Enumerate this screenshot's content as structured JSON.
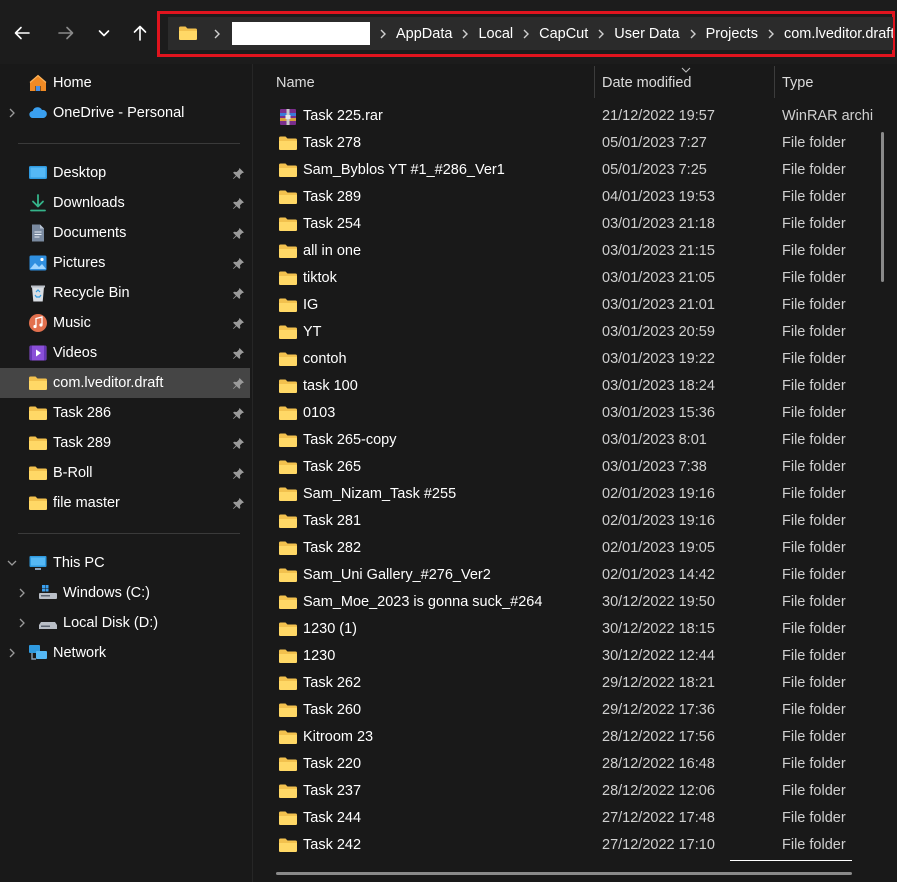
{
  "breadcrumb": {
    "items": [
      "AppData",
      "Local",
      "CapCut",
      "User Data",
      "Projects",
      "com.lveditor.draft"
    ]
  },
  "sidebar": {
    "quick": [
      {
        "label": "Home",
        "icon": "home-icon"
      },
      {
        "label": "OneDrive - Personal",
        "icon": "onedrive-cloud-icon"
      }
    ],
    "pinned": [
      {
        "label": "Desktop",
        "icon": "desktop-icon"
      },
      {
        "label": "Downloads",
        "icon": "download-icon"
      },
      {
        "label": "Documents",
        "icon": "documents-icon"
      },
      {
        "label": "Pictures",
        "icon": "pictures-icon"
      },
      {
        "label": "Recycle Bin",
        "icon": "recycle-bin-icon"
      },
      {
        "label": "Music",
        "icon": "music-icon"
      },
      {
        "label": "Videos",
        "icon": "videos-icon"
      },
      {
        "label": "com.lveditor.draft",
        "icon": "folder-icon"
      },
      {
        "label": "Task 286",
        "icon": "folder-icon"
      },
      {
        "label": "Task 289",
        "icon": "folder-icon"
      },
      {
        "label": "B-Roll",
        "icon": "folder-icon"
      },
      {
        "label": "file master",
        "icon": "folder-icon"
      }
    ],
    "devices": [
      {
        "label": "This PC",
        "icon": "pc-icon"
      },
      {
        "label": "Windows (C:)",
        "icon": "windows-drive-icon"
      },
      {
        "label": "Local Disk (D:)",
        "icon": "disk-drive-icon"
      },
      {
        "label": "Network",
        "icon": "network-icon"
      }
    ]
  },
  "columns": {
    "name": "Name",
    "date": "Date modified",
    "type": "Type"
  },
  "files": [
    {
      "name": "Task 225.rar",
      "date": "21/12/2022 19:57",
      "type": "WinRAR archi",
      "icon": "winrar-icon"
    },
    {
      "name": "Task 278",
      "date": "05/01/2023 7:27",
      "type": "File folder",
      "icon": "folder-icon"
    },
    {
      "name": "Sam_Byblos YT #1_#286_Ver1",
      "date": "05/01/2023 7:25",
      "type": "File folder",
      "icon": "folder-icon"
    },
    {
      "name": "Task 289",
      "date": "04/01/2023 19:53",
      "type": "File folder",
      "icon": "folder-icon"
    },
    {
      "name": "Task 254",
      "date": "03/01/2023 21:18",
      "type": "File folder",
      "icon": "folder-icon"
    },
    {
      "name": "all in one",
      "date": "03/01/2023 21:15",
      "type": "File folder",
      "icon": "folder-icon"
    },
    {
      "name": "tiktok",
      "date": "03/01/2023 21:05",
      "type": "File folder",
      "icon": "folder-icon"
    },
    {
      "name": "IG",
      "date": "03/01/2023 21:01",
      "type": "File folder",
      "icon": "folder-icon"
    },
    {
      "name": "YT",
      "date": "03/01/2023 20:59",
      "type": "File folder",
      "icon": "folder-icon"
    },
    {
      "name": "contoh",
      "date": "03/01/2023 19:22",
      "type": "File folder",
      "icon": "folder-icon"
    },
    {
      "name": "task 100",
      "date": "03/01/2023 18:24",
      "type": "File folder",
      "icon": "folder-icon"
    },
    {
      "name": "0103",
      "date": "03/01/2023 15:36",
      "type": "File folder",
      "icon": "folder-icon"
    },
    {
      "name": "Task 265-copy",
      "date": "03/01/2023 8:01",
      "type": "File folder",
      "icon": "folder-icon"
    },
    {
      "name": "Task 265",
      "date": "03/01/2023 7:38",
      "type": "File folder",
      "icon": "folder-icon"
    },
    {
      "name": "Sam_Nizam_Task #255",
      "date": "02/01/2023 19:16",
      "type": "File folder",
      "icon": "folder-icon"
    },
    {
      "name": "Task 281",
      "date": "02/01/2023 19:16",
      "type": "File folder",
      "icon": "folder-icon"
    },
    {
      "name": "Task 282",
      "date": "02/01/2023 19:05",
      "type": "File folder",
      "icon": "folder-icon"
    },
    {
      "name": "Sam_Uni Gallery_#276_Ver2",
      "date": "02/01/2023 14:42",
      "type": "File folder",
      "icon": "folder-icon"
    },
    {
      "name": "Sam_Moe_2023 is gonna suck_#264",
      "date": "30/12/2022 19:50",
      "type": "File folder",
      "icon": "folder-icon"
    },
    {
      "name": "1230 (1)",
      "date": "30/12/2022 18:15",
      "type": "File folder",
      "icon": "folder-icon"
    },
    {
      "name": "1230",
      "date": "30/12/2022 12:44",
      "type": "File folder",
      "icon": "folder-icon"
    },
    {
      "name": "Task 262",
      "date": "29/12/2022 18:21",
      "type": "File folder",
      "icon": "folder-icon"
    },
    {
      "name": "Task 260",
      "date": "29/12/2022 17:36",
      "type": "File folder",
      "icon": "folder-icon"
    },
    {
      "name": "Kitroom 23",
      "date": "28/12/2022 17:56",
      "type": "File folder",
      "icon": "folder-icon"
    },
    {
      "name": "Task 220",
      "date": "28/12/2022 16:48",
      "type": "File folder",
      "icon": "folder-icon"
    },
    {
      "name": "Task 237",
      "date": "28/12/2022 12:06",
      "type": "File folder",
      "icon": "folder-icon"
    },
    {
      "name": "Task 244",
      "date": "27/12/2022 17:48",
      "type": "File folder",
      "icon": "folder-icon"
    },
    {
      "name": "Task 242",
      "date": "27/12/2022 17:10",
      "type": "File folder",
      "icon": "folder-icon"
    }
  ],
  "colors": {
    "background": "#191919",
    "highlight_border": "#e0141e",
    "folder": "#f2c14e",
    "selected": "#454545"
  }
}
